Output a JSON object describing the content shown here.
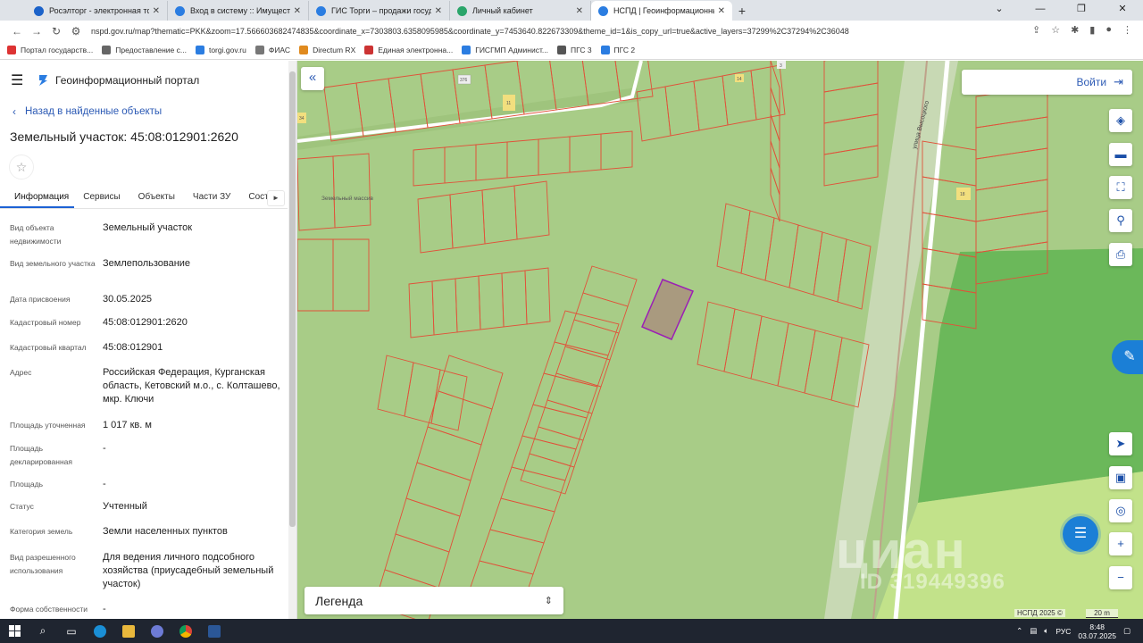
{
  "browser": {
    "tabs": [
      {
        "title": "Росэлторг - электронная торгов...",
        "color": "#1b62c9",
        "active": false
      },
      {
        "title": "Вход в систему :: Имущественн...",
        "color": "#2b7de1",
        "active": false
      },
      {
        "title": "ГИС Торги – продажи государс...",
        "color": "#2b7de1",
        "active": false
      },
      {
        "title": "Личный кабинет",
        "color": "#2aa56a",
        "active": false
      },
      {
        "title": "НСПД | Геоинформационный п...",
        "color": "#2b7de1",
        "active": true
      }
    ],
    "url": "nspd.gov.ru/map?thematic=PKK&zoom=17.566603682474835&coordinate_x=7303803.6358095985&coordinate_y=7453640.822673309&theme_id=1&is_copy_url=true&active_layers=37299%2C37294%2C36048",
    "bookmarks": [
      {
        "label": "Портал государств...",
        "color": "#d33"
      },
      {
        "label": "Предоставление с...",
        "color": "#666"
      },
      {
        "label": "torgi.gov.ru",
        "color": "#2b7de1"
      },
      {
        "label": "ФИАС",
        "color": "#777"
      },
      {
        "label": "Directum RX",
        "color": "#e08a1e"
      },
      {
        "label": "Единая электронна...",
        "color": "#c33"
      },
      {
        "label": "ГИСГМП Админист...",
        "color": "#2b7de1"
      },
      {
        "label": "ПГС 3",
        "color": "#555"
      },
      {
        "label": "ПГС 2",
        "color": "#2b7de1"
      }
    ]
  },
  "panel": {
    "portal_title": "Геоинформационный портал",
    "back_label": "Назад в найденные объекты",
    "object_title": "Земельный участок: 45:08:012901:2620",
    "tabs": [
      "Информация",
      "Сервисы",
      "Объекты",
      "Части ЗУ",
      "Соста"
    ],
    "rows": [
      {
        "key": "Вид объекта недвижимости",
        "value": "Земельный участок"
      },
      {
        "key": "Вид земельного участка",
        "value": "Землепользование"
      },
      {
        "key": "Дата присвоения",
        "value": "30.05.2025"
      },
      {
        "key": "Кадастровый номер",
        "value": "45:08:012901:2620"
      },
      {
        "key": "Кадастровый квартал",
        "value": "45:08:012901"
      },
      {
        "key": "Адрес",
        "value": "Российская Федерация, Курганская область, Кетовский м.о., с. Колташево, мкр. Ключи"
      },
      {
        "key": "Площадь уточненная",
        "value": "1 017 кв. м"
      },
      {
        "key": "Площадь декларированная",
        "value": "-"
      },
      {
        "key": "Площадь",
        "value": "-"
      },
      {
        "key": "Статус",
        "value": "Учтенный"
      },
      {
        "key": "Категория земель",
        "value": "Земли населенных пунктов"
      },
      {
        "key": "Вид разрешенного использования",
        "value": "Для ведения личного подсобного хозяйства (приусадебный земельный участок)"
      },
      {
        "key": "Форма собственности",
        "value": "-"
      }
    ]
  },
  "map": {
    "login_label": "Войти",
    "legend_label": "Легенда",
    "watermark": "циан",
    "watermark_id": "ID 319449396",
    "credit": "НСПД 2025 ©",
    "scale": "20 m",
    "street_label": "улица Высоцкого",
    "place_label": "Земельный массив",
    "parcel_numbers": [
      "376",
      "11",
      "14",
      "18",
      "34",
      "3"
    ],
    "colors": {
      "parcel_fill": "#a8cc87",
      "parcel_line": "#e0523a",
      "selected_fill": "#a99a7f",
      "selected_line": "#9b1fb5",
      "forest": "#6bb85a",
      "field": "#c2e28a"
    }
  },
  "taskbar": {
    "time": "8:48",
    "date": "03.07.2025",
    "lang": "РУС"
  }
}
